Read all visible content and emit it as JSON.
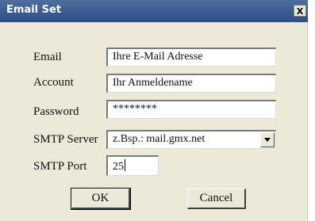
{
  "window": {
    "title": "Email Set",
    "close_glyph": "X"
  },
  "form": {
    "email": {
      "label": "Email",
      "value": "Ihre E-Mail Adresse"
    },
    "account": {
      "label": "Account",
      "value": "Ihr Anmeldename"
    },
    "password": {
      "label": "Password",
      "value": "********"
    },
    "smtp_server": {
      "label": "SMTP Server",
      "value": "z.Bsp.: mail.gmx.net"
    },
    "smtp_port": {
      "label": "SMTP Port",
      "value": "25"
    }
  },
  "buttons": {
    "ok": "OK",
    "cancel": "Cancel"
  }
}
